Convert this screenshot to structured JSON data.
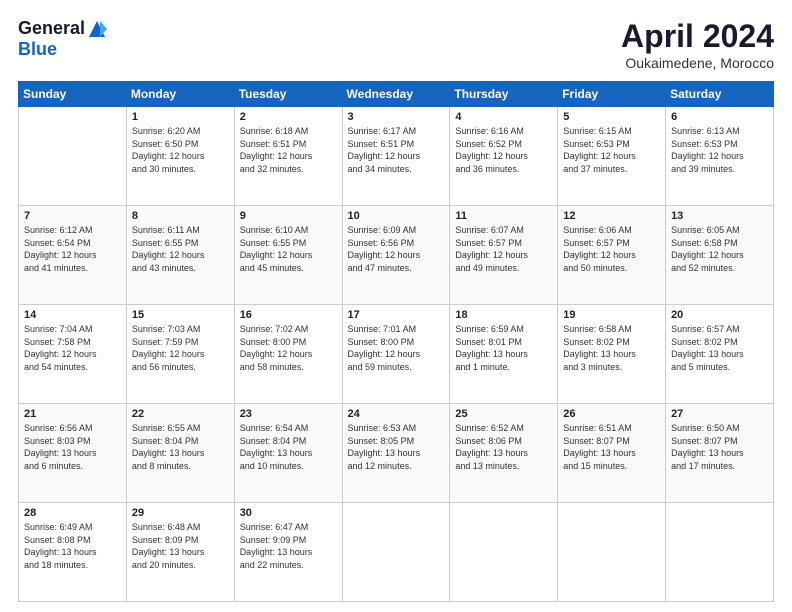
{
  "header": {
    "logo_general": "General",
    "logo_blue": "Blue",
    "title": "April 2024",
    "location": "Oukaimedene, Morocco"
  },
  "days_of_week": [
    "Sunday",
    "Monday",
    "Tuesday",
    "Wednesday",
    "Thursday",
    "Friday",
    "Saturday"
  ],
  "weeks": [
    [
      {
        "num": "",
        "info": ""
      },
      {
        "num": "1",
        "info": "Sunrise: 6:20 AM\nSunset: 6:50 PM\nDaylight: 12 hours\nand 30 minutes."
      },
      {
        "num": "2",
        "info": "Sunrise: 6:18 AM\nSunset: 6:51 PM\nDaylight: 12 hours\nand 32 minutes."
      },
      {
        "num": "3",
        "info": "Sunrise: 6:17 AM\nSunset: 6:51 PM\nDaylight: 12 hours\nand 34 minutes."
      },
      {
        "num": "4",
        "info": "Sunrise: 6:16 AM\nSunset: 6:52 PM\nDaylight: 12 hours\nand 36 minutes."
      },
      {
        "num": "5",
        "info": "Sunrise: 6:15 AM\nSunset: 6:53 PM\nDaylight: 12 hours\nand 37 minutes."
      },
      {
        "num": "6",
        "info": "Sunrise: 6:13 AM\nSunset: 6:53 PM\nDaylight: 12 hours\nand 39 minutes."
      }
    ],
    [
      {
        "num": "7",
        "info": "Sunrise: 6:12 AM\nSunset: 6:54 PM\nDaylight: 12 hours\nand 41 minutes."
      },
      {
        "num": "8",
        "info": "Sunrise: 6:11 AM\nSunset: 6:55 PM\nDaylight: 12 hours\nand 43 minutes."
      },
      {
        "num": "9",
        "info": "Sunrise: 6:10 AM\nSunset: 6:55 PM\nDaylight: 12 hours\nand 45 minutes."
      },
      {
        "num": "10",
        "info": "Sunrise: 6:09 AM\nSunset: 6:56 PM\nDaylight: 12 hours\nand 47 minutes."
      },
      {
        "num": "11",
        "info": "Sunrise: 6:07 AM\nSunset: 6:57 PM\nDaylight: 12 hours\nand 49 minutes."
      },
      {
        "num": "12",
        "info": "Sunrise: 6:06 AM\nSunset: 6:57 PM\nDaylight: 12 hours\nand 50 minutes."
      },
      {
        "num": "13",
        "info": "Sunrise: 6:05 AM\nSunset: 6:58 PM\nDaylight: 12 hours\nand 52 minutes."
      }
    ],
    [
      {
        "num": "14",
        "info": "Sunrise: 7:04 AM\nSunset: 7:58 PM\nDaylight: 12 hours\nand 54 minutes."
      },
      {
        "num": "15",
        "info": "Sunrise: 7:03 AM\nSunset: 7:59 PM\nDaylight: 12 hours\nand 56 minutes."
      },
      {
        "num": "16",
        "info": "Sunrise: 7:02 AM\nSunset: 8:00 PM\nDaylight: 12 hours\nand 58 minutes."
      },
      {
        "num": "17",
        "info": "Sunrise: 7:01 AM\nSunset: 8:00 PM\nDaylight: 12 hours\nand 59 minutes."
      },
      {
        "num": "18",
        "info": "Sunrise: 6:59 AM\nSunset: 8:01 PM\nDaylight: 13 hours\nand 1 minute."
      },
      {
        "num": "19",
        "info": "Sunrise: 6:58 AM\nSunset: 8:02 PM\nDaylight: 13 hours\nand 3 minutes."
      },
      {
        "num": "20",
        "info": "Sunrise: 6:57 AM\nSunset: 8:02 PM\nDaylight: 13 hours\nand 5 minutes."
      }
    ],
    [
      {
        "num": "21",
        "info": "Sunrise: 6:56 AM\nSunset: 8:03 PM\nDaylight: 13 hours\nand 6 minutes."
      },
      {
        "num": "22",
        "info": "Sunrise: 6:55 AM\nSunset: 8:04 PM\nDaylight: 13 hours\nand 8 minutes."
      },
      {
        "num": "23",
        "info": "Sunrise: 6:54 AM\nSunset: 8:04 PM\nDaylight: 13 hours\nand 10 minutes."
      },
      {
        "num": "24",
        "info": "Sunrise: 6:53 AM\nSunset: 8:05 PM\nDaylight: 13 hours\nand 12 minutes."
      },
      {
        "num": "25",
        "info": "Sunrise: 6:52 AM\nSunset: 8:06 PM\nDaylight: 13 hours\nand 13 minutes."
      },
      {
        "num": "26",
        "info": "Sunrise: 6:51 AM\nSunset: 8:07 PM\nDaylight: 13 hours\nand 15 minutes."
      },
      {
        "num": "27",
        "info": "Sunrise: 6:50 AM\nSunset: 8:07 PM\nDaylight: 13 hours\nand 17 minutes."
      }
    ],
    [
      {
        "num": "28",
        "info": "Sunrise: 6:49 AM\nSunset: 8:08 PM\nDaylight: 13 hours\nand 18 minutes."
      },
      {
        "num": "29",
        "info": "Sunrise: 6:48 AM\nSunset: 8:09 PM\nDaylight: 13 hours\nand 20 minutes."
      },
      {
        "num": "30",
        "info": "Sunrise: 6:47 AM\nSunset: 9:09 PM\nDaylight: 13 hours\nand 22 minutes."
      },
      {
        "num": "",
        "info": ""
      },
      {
        "num": "",
        "info": ""
      },
      {
        "num": "",
        "info": ""
      },
      {
        "num": "",
        "info": ""
      }
    ]
  ]
}
